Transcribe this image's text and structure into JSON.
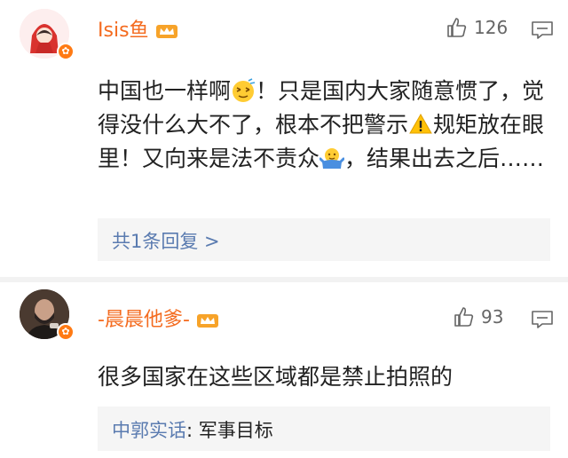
{
  "comments": [
    {
      "username": "Isis鱼",
      "like_count": "126",
      "text_parts": [
        "中国也一样啊",
        "！只是国内大家随意惯了，觉得没什么大不了，根本不把警示",
        "规矩放在眼里！又向来是法不责众",
        "，结果出去之后……"
      ],
      "reply_summary": "共1条回复 >"
    },
    {
      "username": "-晨晨他爹-",
      "like_count": "93",
      "text": "很多国家在这些区域都是禁止拍照的",
      "reply_author": "中郭实话",
      "reply_text": ": 军事目标"
    }
  ],
  "colors": {
    "username": "#f46b1f",
    "link": "#5a7bb0",
    "badge": "#ff7a14",
    "reply_bg": "#f5f5f5"
  }
}
